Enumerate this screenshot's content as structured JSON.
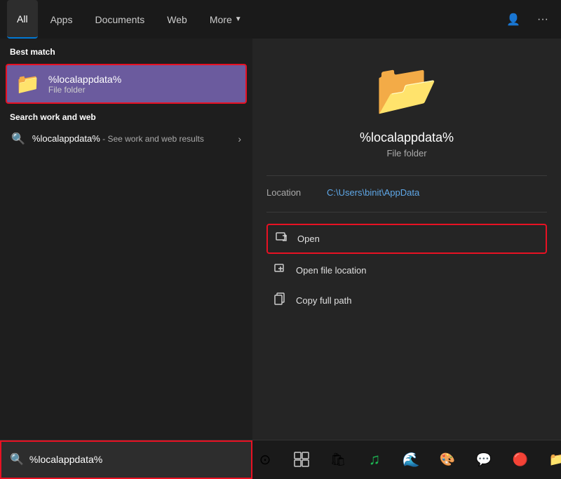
{
  "nav": {
    "tabs": [
      {
        "label": "All",
        "active": true
      },
      {
        "label": "Apps",
        "active": false
      },
      {
        "label": "Documents",
        "active": false
      },
      {
        "label": "Web",
        "active": false
      },
      {
        "label": "More",
        "active": false,
        "hasDropdown": true
      }
    ],
    "right_icons": [
      "person-icon",
      "more-icon"
    ]
  },
  "left_panel": {
    "best_match_label": "Best match",
    "best_match": {
      "title": "%localappdata%",
      "subtitle": "File folder"
    },
    "search_section_label": "Search work and web",
    "search_item": {
      "query": "%localappdata%",
      "rest": " - See work and web results"
    }
  },
  "right_panel": {
    "title": "%localappdata%",
    "type": "File folder",
    "meta_label": "Location",
    "meta_value": "C:\\Users\\binit\\AppData",
    "actions": [
      {
        "label": "Open",
        "highlighted": true
      },
      {
        "label": "Open file location"
      },
      {
        "label": "Copy full path"
      }
    ]
  },
  "taskbar": {
    "search_placeholder": "%localappdata%",
    "search_value": "%localappdata%",
    "icons": [
      {
        "name": "start-search-icon",
        "symbol": "⊙"
      },
      {
        "name": "task-view-icon",
        "symbol": "⧉"
      },
      {
        "name": "store-icon",
        "symbol": "🛍"
      },
      {
        "name": "spotify-icon",
        "symbol": "♫"
      },
      {
        "name": "edge-icon",
        "symbol": "🌐"
      },
      {
        "name": "photos-icon",
        "symbol": "🎨"
      },
      {
        "name": "teams-icon",
        "symbol": "💬"
      },
      {
        "name": "chrome-icon",
        "symbol": "◎"
      },
      {
        "name": "explorer-icon",
        "symbol": "📁"
      }
    ]
  }
}
